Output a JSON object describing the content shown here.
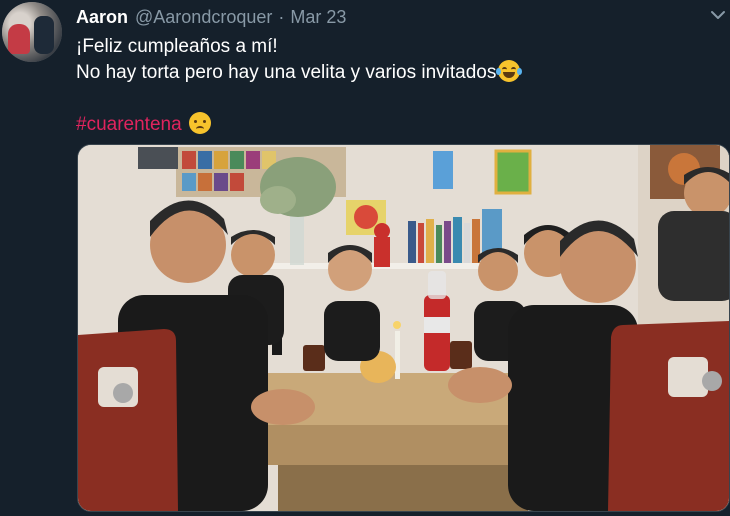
{
  "tweet": {
    "display_name": "Aaron",
    "handle": "@Aarondcroquer",
    "separator": "·",
    "date": "Mar 23",
    "lines": [
      "¡Feliz cumpleaños a mí!",
      "No hay torta pero hay una velita y varios invitados"
    ],
    "hashtag": "#cuarentena"
  },
  "icons": {
    "caret": "chevron-down-icon",
    "emoji_line": "face-with-tears-of-joy-icon",
    "emoji_hashtag": "disappointed-face-icon"
  },
  "colors": {
    "background": "#15202b",
    "secondary_text": "#8899a6",
    "hashtag": "#e0245e",
    "border": "#38444d"
  }
}
